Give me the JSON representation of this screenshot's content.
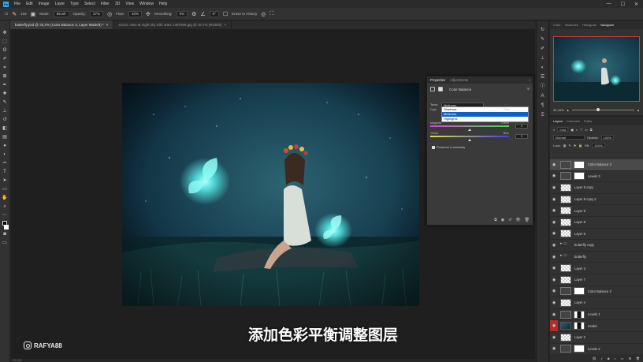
{
  "menu": [
    "File",
    "Edit",
    "Image",
    "Layer",
    "Type",
    "Select",
    "Filter",
    "3D",
    "View",
    "Window",
    "Help"
  ],
  "window_controls": [
    "—",
    "☐",
    "✕"
  ],
  "options": {
    "brush_size": "102",
    "mode_label": "Mode:",
    "mode_value": "Brush",
    "opacity_label": "Opacity:",
    "opacity_value": "37%",
    "flow_label": "Flow:",
    "flow_value": "40%",
    "smoothing_label": "Smoothing:",
    "smoothing_value": "0%",
    "angle_value": "0°",
    "erase_label": "Erase to History"
  },
  "tabs": [
    {
      "label": "butterfly.psd @ 33,2% (Color Balance 3, Layer Mask/8) *",
      "close": "×"
    },
    {
      "label": "scenic view at night sky with stars 1487699.jpg @ 16,7% (RGB/8)",
      "close": "×"
    }
  ],
  "status": "33,18%",
  "properties": {
    "tab_properties": "Properties",
    "tab_adjustments": "Adjustments",
    "title": "Color Balance",
    "tone_label": "Tone:",
    "tone_value": "Midtones",
    "tone_options": [
      "Shadows",
      "Midtones",
      "Highlights"
    ],
    "cyan_label": "Cyan",
    "red_label": "Red",
    "magenta_label": "Magenta",
    "green_label": "Green",
    "yellow_label": "Yellow",
    "blue_label": "Blue",
    "cyan_value": "0",
    "magenta_value": "0",
    "yellow_value": "0",
    "preserve_label": "Preserve Luminosity",
    "menu_icon": "≡",
    "collapse_icon": "»"
  },
  "navigator": {
    "tabs": [
      "Color",
      "Swatches",
      "Histogram",
      "Navigator"
    ],
    "zoom": "33,18%"
  },
  "layers": {
    "tabs": [
      "Layers",
      "Channels",
      "Paths"
    ],
    "filter_label": "Kind",
    "blend_mode": "Normal",
    "opacity_label": "Opacity:",
    "opacity_value": "100%",
    "lock_label": "Lock:",
    "fill_label": "Fill:",
    "fill_value": "100%",
    "items": [
      {
        "name": "Color Balance 3",
        "thumb": "adj",
        "mask": "mask",
        "selected": true
      },
      {
        "name": "Levels 3",
        "thumb": "adj",
        "mask": "mask",
        "selected": false
      },
      {
        "name": "Layer 9 copy",
        "thumb": "checker",
        "mask": "",
        "selected": false
      },
      {
        "name": "Layer 9 copy 2",
        "thumb": "checker",
        "mask": "",
        "selected": false
      },
      {
        "name": "Layer 8",
        "thumb": "checker",
        "mask": "",
        "selected": false
      },
      {
        "name": "Layer 8",
        "thumb": "checker",
        "mask": "",
        "selected": false
      },
      {
        "name": "Layer 6",
        "thumb": "checker",
        "mask": "",
        "selected": false
      },
      {
        "name": "butterfly copy",
        "thumb": "folder",
        "mask": "",
        "selected": false
      },
      {
        "name": "butterfly",
        "thumb": "folder",
        "mask": "",
        "selected": false
      },
      {
        "name": "Layer 3",
        "thumb": "checker",
        "mask": "",
        "selected": false
      },
      {
        "name": "Layer 7",
        "thumb": "checker",
        "mask": "",
        "selected": false
      },
      {
        "name": "Color Balance 2",
        "thumb": "adj",
        "mask": "mask",
        "selected": false
      },
      {
        "name": "Layer 4",
        "thumb": "checker",
        "mask": "",
        "selected": false
      },
      {
        "name": "Levels 1",
        "thumb": "adj",
        "mask": "maskdark",
        "selected": false
      },
      {
        "name": "model",
        "thumb": "img",
        "mask": "maskdark",
        "selected": false
      },
      {
        "name": "Layer 2",
        "thumb": "checker",
        "mask": "",
        "selected": false
      },
      {
        "name": "Levels 2",
        "thumb": "adj",
        "mask": "mask",
        "selected": false
      }
    ],
    "footer_icons": [
      "link-icon",
      "fx-icon",
      "mask-icon",
      "adjustment-icon",
      "folder-icon",
      "new-layer-icon",
      "trash-icon"
    ]
  },
  "subtitle": "添加色彩平衡调整图层",
  "watermark": "RAFYA88",
  "colors": {
    "accent": "#31a8ff",
    "selection_blue": "#0d62c8",
    "glow": "#59f3ee",
    "navigator_frame": "#d23a3a"
  }
}
